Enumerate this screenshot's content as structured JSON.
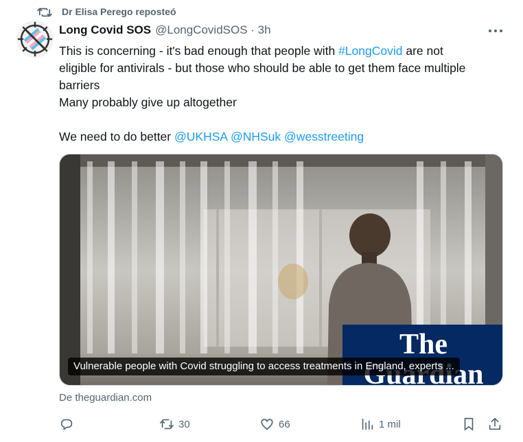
{
  "repost": {
    "text": "Dr Elisa Perego reposteó"
  },
  "author": {
    "display_name": "Long Covid SOS",
    "handle_time": "@LongCovidSOS · 3h"
  },
  "tweet": {
    "line1_a": "This is concerning - it's bad enough that people with ",
    "line1_hashtag": "#LongCovid",
    "line1_b": " are not",
    "line2": "eligible for antivirals - but those who should be able to get them face multiple",
    "line3": "barriers",
    "line4": "Many probably give up altogether",
    "line6_a": "We need to do better ",
    "mention1": "@UKHSA",
    "mention2": "@NHSuk",
    "mention3": "@wesstreeting"
  },
  "card": {
    "title": "Vulnerable people with Covid struggling to access treatments in England, experts ...",
    "logo_line1": "The",
    "logo_line2": "Guardian",
    "source": "De theguardian.com"
  },
  "actions": {
    "reply_count": "",
    "repost_count": "30",
    "like_count": "66",
    "views_count": "1 mil"
  },
  "colors": {
    "link": "#1d9bf0",
    "secondary_text": "#536471",
    "guardian_blue": "#052962"
  },
  "icons": [
    "repost-icon",
    "more-icon",
    "reply-icon",
    "repost-icon",
    "like-icon",
    "views-icon",
    "bookmark-icon",
    "share-icon"
  ]
}
